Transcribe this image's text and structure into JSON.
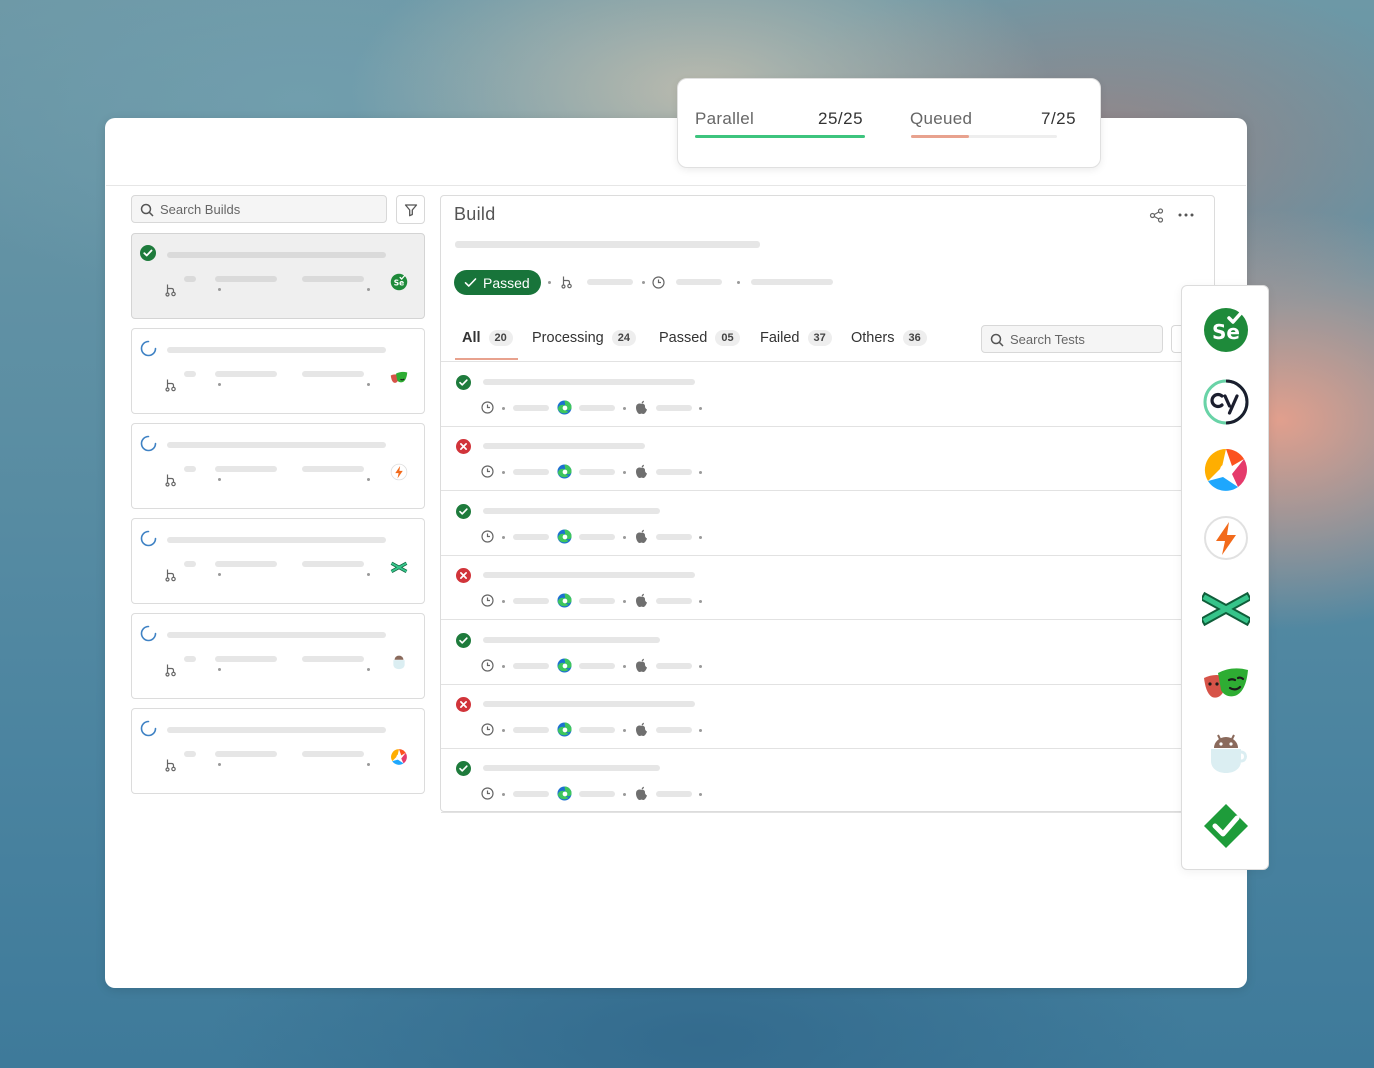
{
  "stats": {
    "parallel_label": "Parallel",
    "parallel_value": "25/25",
    "parallel_progress": 1.0,
    "queued_label": "Queued",
    "queued_value": "7/25",
    "queued_progress": 0.4
  },
  "sidebar": {
    "search_placeholder": "Search Builds",
    "builds": [
      {
        "status": "passed",
        "framework": "selenium-icon",
        "selected": true
      },
      {
        "status": "loading",
        "framework": "playwright-icon"
      },
      {
        "status": "loading",
        "framework": "lightning-icon"
      },
      {
        "status": "loading",
        "framework": "testcafe-icon"
      },
      {
        "status": "loading",
        "framework": "espresso-icon"
      },
      {
        "status": "loading",
        "framework": "chromatic-icon"
      }
    ]
  },
  "build": {
    "title": "Build",
    "status_label": "Passed",
    "tabs": [
      {
        "label": "All",
        "count": "20"
      },
      {
        "label": "Processing",
        "count": "24"
      },
      {
        "label": "Passed",
        "count": "05"
      },
      {
        "label": "Failed",
        "count": "37"
      },
      {
        "label": "Others",
        "count": "36"
      }
    ],
    "search_tests_placeholder": "Search Tests",
    "tests": [
      {
        "status": "passed"
      },
      {
        "status": "failed"
      },
      {
        "status": "passed"
      },
      {
        "status": "failed"
      },
      {
        "status": "passed"
      },
      {
        "status": "failed"
      },
      {
        "status": "passed"
      }
    ]
  },
  "frameworks": [
    "selenium-icon",
    "cypress-icon",
    "chromatic-icon",
    "lightning-icon",
    "testcafe-icon",
    "playwright-icon",
    "espresso-icon",
    "checkmark-icon"
  ],
  "colors": {
    "pass_green": "#1e7b3c",
    "fail_red": "#d1343a",
    "progress_green": "#3dc47e",
    "progress_salmon": "#e8a28e",
    "badge_green": "#18743a"
  }
}
